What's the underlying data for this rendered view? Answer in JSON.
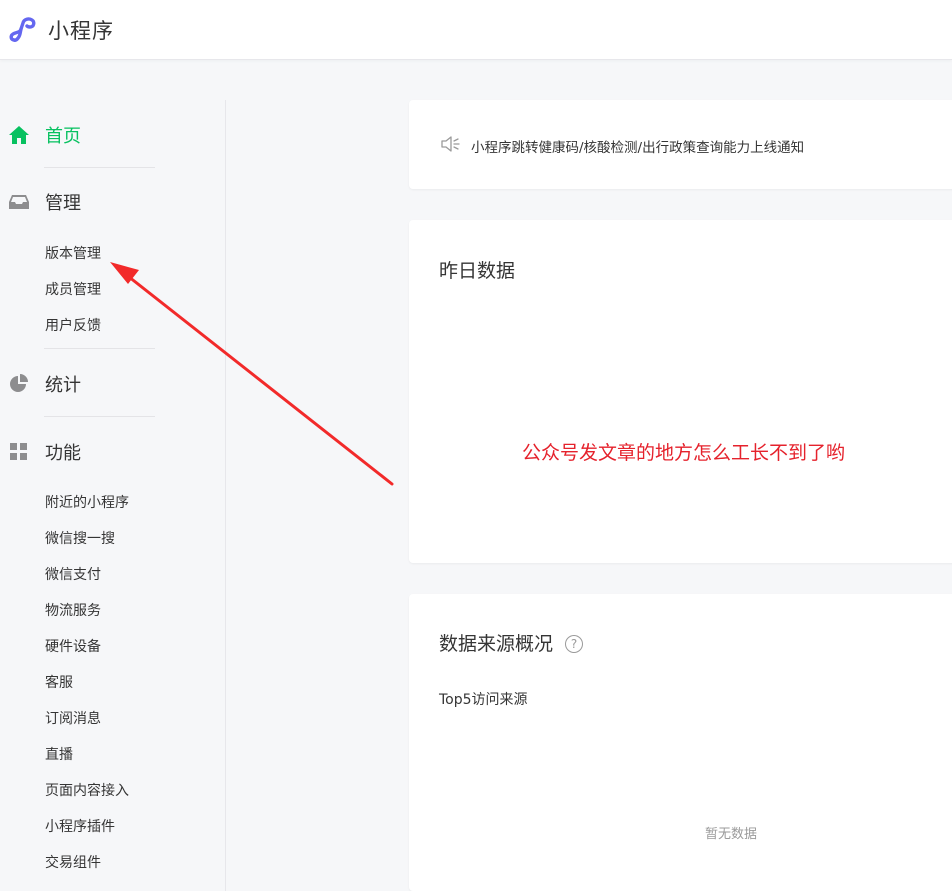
{
  "header": {
    "title": "小程序",
    "logo_icon": "miniprogram-logo-icon",
    "logo_color": "#6467f0"
  },
  "sidebar": {
    "accent_color": "#07c160",
    "home": {
      "label": "首页",
      "icon": "home-icon"
    },
    "manage": {
      "label": "管理",
      "icon": "inbox-icon",
      "items": [
        "版本管理",
        "成员管理",
        "用户反馈"
      ]
    },
    "stats": {
      "label": "统计",
      "icon": "pie-chart-icon"
    },
    "features": {
      "label": "功能",
      "icon": "grid-icon",
      "items": [
        "附近的小程序",
        "微信搜一搜",
        "微信支付",
        "物流服务",
        "硬件设备",
        "客服",
        "订阅消息",
        "直播",
        "页面内容接入",
        "小程序插件",
        "交易组件"
      ]
    }
  },
  "notice": {
    "icon": "speaker-icon",
    "text": "小程序跳转健康码/核酸检测/出行政策查询能力上线通知"
  },
  "yesterday": {
    "title": "昨日数据",
    "annotation": "公众号发文章的地方怎么工长不到了哟",
    "annotation_color": "#e5222c"
  },
  "sources": {
    "title": "数据来源概况",
    "help": "?",
    "top5_label": "Top5访问来源",
    "empty_text": "暂无数据"
  },
  "annotation_arrow": {
    "color": "#f22a2a",
    "points_to": "版本管理"
  }
}
